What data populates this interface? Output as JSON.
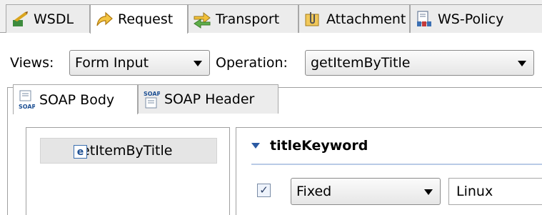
{
  "top_tabs": [
    {
      "label": "WSDL",
      "icon": "wsdl-icon"
    },
    {
      "label": "Request",
      "icon": "request-arrow-icon",
      "active": true
    },
    {
      "label": "Transport",
      "icon": "transport-icon"
    },
    {
      "label": "Attachment",
      "icon": "attachment-icon"
    },
    {
      "label": "WS-Policy",
      "icon": "ws-policy-icon"
    }
  ],
  "toolbar": {
    "views_label": "Views:",
    "views_value": "Form Input",
    "operation_label": "Operation:",
    "operation_value": "getItemByTitle"
  },
  "inner_tabs": [
    {
      "label": "SOAP Body",
      "icon": "soap-body-icon",
      "active": true
    },
    {
      "label": "SOAP Header",
      "icon": "soap-header-icon"
    }
  ],
  "tree": {
    "items": [
      {
        "label": "getItemByTitle",
        "icon_letter": "e"
      }
    ]
  },
  "form": {
    "section_title": "titleKeyword",
    "checked": true,
    "mode_value": "Fixed",
    "value": "Linux"
  },
  "colors": {
    "tab_border": "#a7a7a7",
    "section_accent": "#2b5aa3",
    "selection": "#e5e5e5"
  }
}
